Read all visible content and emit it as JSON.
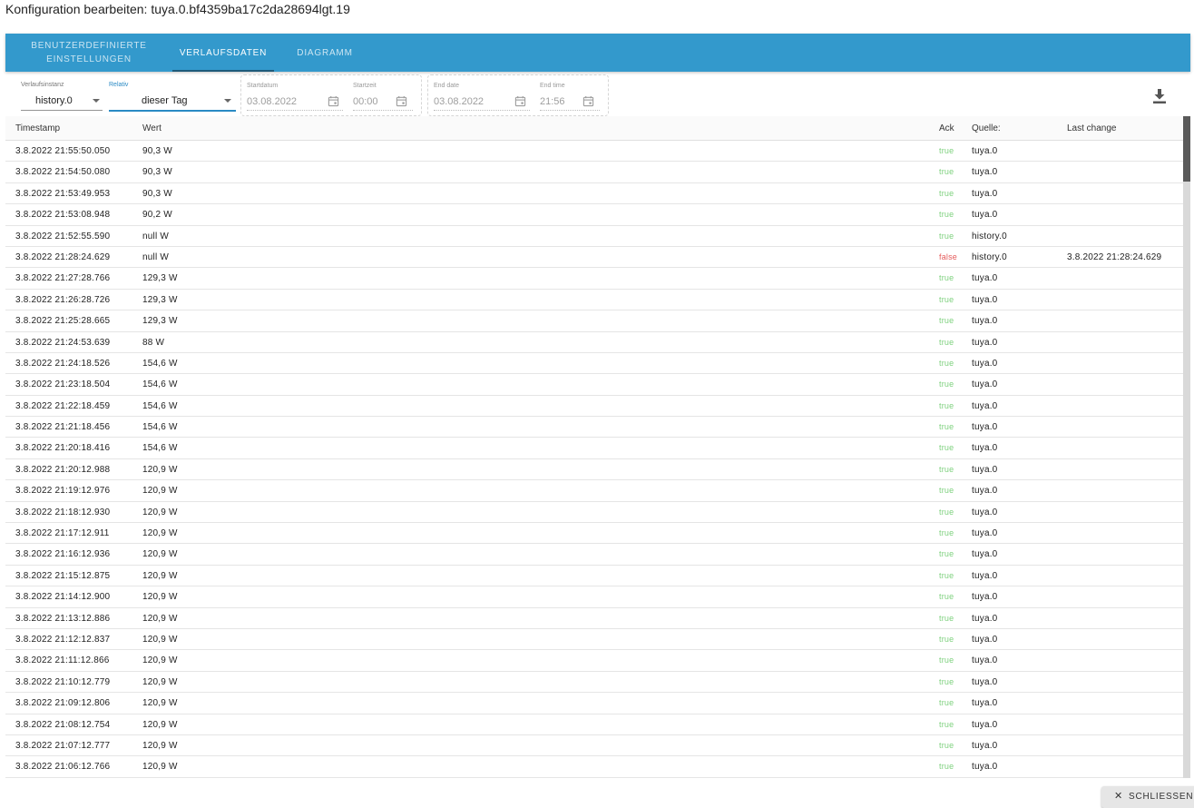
{
  "dialog": {
    "title": "Konfiguration bearbeiten: tuya.0.bf4359ba17c2da28694lgt.19"
  },
  "tabs": [
    {
      "label": "BENUTZERDEFINIERTE EINSTELLUNGEN"
    },
    {
      "label": "VERLAUFSDATEN",
      "active": true
    },
    {
      "label": "DIAGRAMM"
    }
  ],
  "filters": {
    "instance": {
      "label": "Verlaufsinstanz",
      "value": "history.0"
    },
    "relative": {
      "label": "Relativ",
      "value": "dieser Tag"
    },
    "start_date": {
      "label": "Startdatum",
      "value": "03.08.2022"
    },
    "start_time": {
      "label": "Startzeit",
      "value": "00:00"
    },
    "end_date": {
      "label": "End date",
      "value": "03.08.2022"
    },
    "end_time": {
      "label": "End time",
      "value": "21:56"
    }
  },
  "table": {
    "headers": {
      "timestamp": "Timestamp",
      "value": "Wert",
      "ack": "Ack",
      "source": "Quelle:",
      "last_change": "Last change"
    },
    "rows": [
      [
        "3.8.2022 21:55:50.050",
        "90,3 W",
        "true",
        "tuya.0",
        ""
      ],
      [
        "3.8.2022 21:54:50.080",
        "90,3 W",
        "true",
        "tuya.0",
        ""
      ],
      [
        "3.8.2022 21:53:49.953",
        "90,3 W",
        "true",
        "tuya.0",
        ""
      ],
      [
        "3.8.2022 21:53:08.948",
        "90,2 W",
        "true",
        "tuya.0",
        ""
      ],
      [
        "3.8.2022 21:52:55.590",
        "null W",
        "true",
        "history.0",
        ""
      ],
      [
        "3.8.2022 21:28:24.629",
        "null W",
        "false",
        "history.0",
        "3.8.2022 21:28:24.629"
      ],
      [
        "3.8.2022 21:27:28.766",
        "129,3 W",
        "true",
        "tuya.0",
        ""
      ],
      [
        "3.8.2022 21:26:28.726",
        "129,3 W",
        "true",
        "tuya.0",
        ""
      ],
      [
        "3.8.2022 21:25:28.665",
        "129,3 W",
        "true",
        "tuya.0",
        ""
      ],
      [
        "3.8.2022 21:24:53.639",
        "88 W",
        "true",
        "tuya.0",
        ""
      ],
      [
        "3.8.2022 21:24:18.526",
        "154,6 W",
        "true",
        "tuya.0",
        ""
      ],
      [
        "3.8.2022 21:23:18.504",
        "154,6 W",
        "true",
        "tuya.0",
        ""
      ],
      [
        "3.8.2022 21:22:18.459",
        "154,6 W",
        "true",
        "tuya.0",
        ""
      ],
      [
        "3.8.2022 21:21:18.456",
        "154,6 W",
        "true",
        "tuya.0",
        ""
      ],
      [
        "3.8.2022 21:20:18.416",
        "154,6 W",
        "true",
        "tuya.0",
        ""
      ],
      [
        "3.8.2022 21:20:12.988",
        "120,9 W",
        "true",
        "tuya.0",
        ""
      ],
      [
        "3.8.2022 21:19:12.976",
        "120,9 W",
        "true",
        "tuya.0",
        ""
      ],
      [
        "3.8.2022 21:18:12.930",
        "120,9 W",
        "true",
        "tuya.0",
        ""
      ],
      [
        "3.8.2022 21:17:12.911",
        "120,9 W",
        "true",
        "tuya.0",
        ""
      ],
      [
        "3.8.2022 21:16:12.936",
        "120,9 W",
        "true",
        "tuya.0",
        ""
      ],
      [
        "3.8.2022 21:15:12.875",
        "120,9 W",
        "true",
        "tuya.0",
        ""
      ],
      [
        "3.8.2022 21:14:12.900",
        "120,9 W",
        "true",
        "tuya.0",
        ""
      ],
      [
        "3.8.2022 21:13:12.886",
        "120,9 W",
        "true",
        "tuya.0",
        ""
      ],
      [
        "3.8.2022 21:12:12.837",
        "120,9 W",
        "true",
        "tuya.0",
        ""
      ],
      [
        "3.8.2022 21:11:12.866",
        "120,9 W",
        "true",
        "tuya.0",
        ""
      ],
      [
        "3.8.2022 21:10:12.779",
        "120,9 W",
        "true",
        "tuya.0",
        ""
      ],
      [
        "3.8.2022 21:09:12.806",
        "120,9 W",
        "true",
        "tuya.0",
        ""
      ],
      [
        "3.8.2022 21:08:12.754",
        "120,9 W",
        "true",
        "tuya.0",
        ""
      ],
      [
        "3.8.2022 21:07:12.777",
        "120,9 W",
        "true",
        "tuya.0",
        ""
      ],
      [
        "3.8.2022 21:06:12.766",
        "120,9 W",
        "true",
        "tuya.0",
        ""
      ]
    ]
  },
  "actions": {
    "close_label": "SCHLIESSEN"
  },
  "icons": {
    "calendar": "calendar-icon",
    "download": "download-icon",
    "dropdown": "chevron-down-icon",
    "close": "close-icon"
  },
  "colors": {
    "tabbar": "#3399cc",
    "ack_true": "#7ed17e",
    "ack_false": "#e55b5b"
  }
}
